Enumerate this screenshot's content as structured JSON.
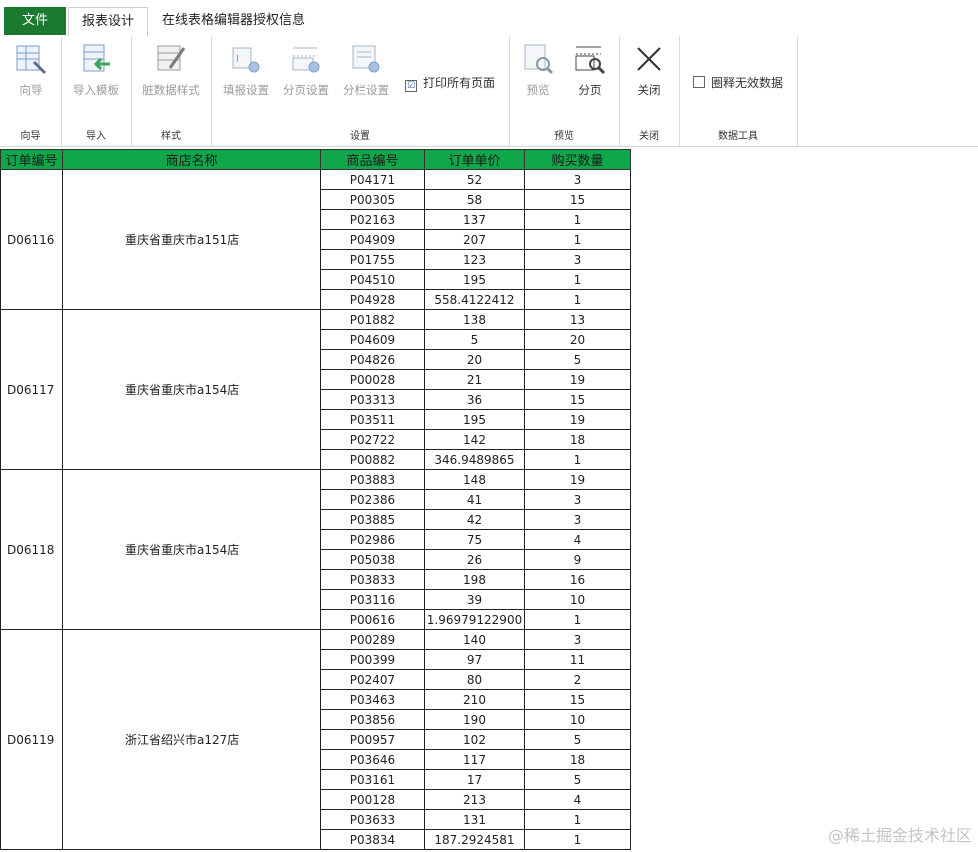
{
  "tabs": {
    "file": "文件",
    "design": "报表设计",
    "info": "在线表格编辑器授权信息"
  },
  "ribbon": {
    "groups": {
      "guide": "向导",
      "import": "导入",
      "style": "样式",
      "settings": "设置",
      "preview": "预览",
      "close": "关闭",
      "datatools": "数据工具"
    },
    "buttons": {
      "guide": "向导",
      "import_template": "导入模板",
      "dirty_style": "脏数据样式",
      "fill_settings": "填报设置",
      "page_settings": "分页设置",
      "column_settings": "分栏设置",
      "preview": "预览",
      "paging": "分页",
      "close": "关闭"
    },
    "checkboxes": {
      "print_all": "打印所有页面",
      "print_all_checked": "☑",
      "circle_invalid": "圈释无效数据"
    }
  },
  "table": {
    "headers": [
      "订单编号",
      "商店名称",
      "商品编号",
      "订单单价",
      "购买数量"
    ],
    "orders": [
      {
        "id": "D06116",
        "store": "重庆省重庆市a151店",
        "items": [
          [
            "P04171",
            "52",
            "3"
          ],
          [
            "P00305",
            "58",
            "15"
          ],
          [
            "P02163",
            "137",
            "1"
          ],
          [
            "P04909",
            "207",
            "1"
          ],
          [
            "P01755",
            "123",
            "3"
          ],
          [
            "P04510",
            "195",
            "1"
          ],
          [
            "P04928",
            "558.4122412",
            "1"
          ]
        ]
      },
      {
        "id": "D06117",
        "store": "重庆省重庆市a154店",
        "items": [
          [
            "P01882",
            "138",
            "13"
          ],
          [
            "P04609",
            "5",
            "20"
          ],
          [
            "P04826",
            "20",
            "5"
          ],
          [
            "P00028",
            "21",
            "19"
          ],
          [
            "P03313",
            "36",
            "15"
          ],
          [
            "P03511",
            "195",
            "19"
          ],
          [
            "P02722",
            "142",
            "18"
          ],
          [
            "P00882",
            "346.9489865",
            "1"
          ]
        ]
      },
      {
        "id": "D06118",
        "store": "重庆省重庆市a154店",
        "items": [
          [
            "P03883",
            "148",
            "19"
          ],
          [
            "P02386",
            "41",
            "3"
          ],
          [
            "P03885",
            "42",
            "3"
          ],
          [
            "P02986",
            "75",
            "4"
          ],
          [
            "P05038",
            "26",
            "9"
          ],
          [
            "P03833",
            "198",
            "16"
          ],
          [
            "P03116",
            "39",
            "10"
          ],
          [
            "P00616",
            "1.96979122900",
            "1"
          ]
        ]
      },
      {
        "id": "D06119",
        "store": "浙江省绍兴市a127店",
        "items": [
          [
            "P00289",
            "140",
            "3"
          ],
          [
            "P00399",
            "97",
            "11"
          ],
          [
            "P02407",
            "80",
            "2"
          ],
          [
            "P03463",
            "210",
            "15"
          ],
          [
            "P03856",
            "190",
            "10"
          ],
          [
            "P00957",
            "102",
            "5"
          ],
          [
            "P03646",
            "117",
            "18"
          ],
          [
            "P03161",
            "17",
            "5"
          ],
          [
            "P00128",
            "213",
            "4"
          ],
          [
            "P03633",
            "131",
            "1"
          ],
          [
            "P03834",
            "187.2924581",
            "1"
          ]
        ]
      }
    ]
  },
  "watermark": "@稀土掘金技术社区",
  "colors": {
    "header_green": "#0fa74a",
    "file_tab_green": "#1b7a2f"
  }
}
